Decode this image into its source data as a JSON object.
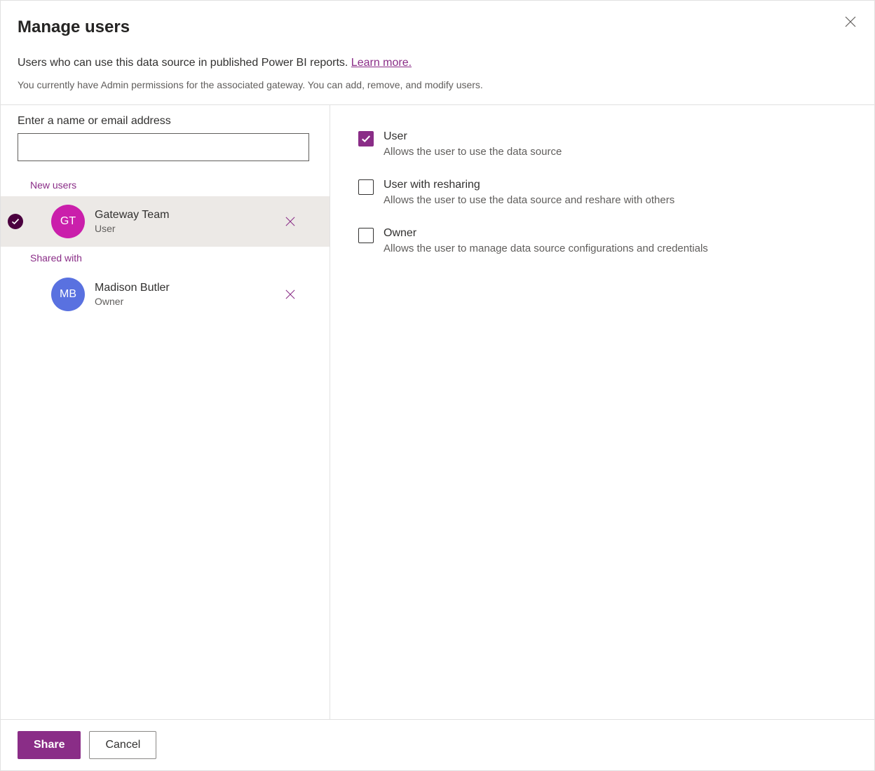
{
  "header": {
    "title": "Manage users",
    "description_prefix": "Users who can use this data source in published Power BI reports. ",
    "learn_more": "Learn more.",
    "subdescription": "You currently have Admin permissions for the associated gateway. You can add, remove, and modify users."
  },
  "left": {
    "input_label": "Enter a name or email address",
    "input_value": "",
    "new_users_label": "New users",
    "shared_with_label": "Shared with",
    "new_users": [
      {
        "initials": "GT",
        "name": "Gateway Team",
        "role": "User",
        "avatar_color": "magenta",
        "selected": true
      }
    ],
    "shared_with": [
      {
        "initials": "MB",
        "name": "Madison Butler",
        "role": "Owner",
        "avatar_color": "blue",
        "selected": false
      }
    ]
  },
  "permissions": [
    {
      "key": "user",
      "title": "User",
      "desc": "Allows the user to use the data source",
      "checked": true
    },
    {
      "key": "resharing",
      "title": "User with resharing",
      "desc": "Allows the user to use the data source and reshare with others",
      "checked": false
    },
    {
      "key": "owner",
      "title": "Owner",
      "desc": "Allows the user to manage data source configurations and credentials",
      "checked": false
    }
  ],
  "footer": {
    "share": "Share",
    "cancel": "Cancel"
  }
}
